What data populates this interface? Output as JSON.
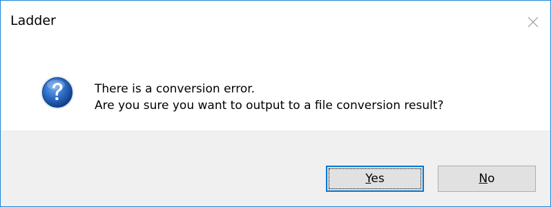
{
  "window": {
    "title": "Ladder"
  },
  "message": {
    "line1": "There is a conversion error.",
    "line2": "Are you sure you want to output to a file conversion result?"
  },
  "buttons": {
    "yes": {
      "mnemonic": "Y",
      "rest": "es"
    },
    "no": {
      "mnemonic": "N",
      "rest": "o"
    }
  },
  "icons": {
    "title_close": "close-icon",
    "message_icon": "question-icon"
  },
  "colors": {
    "window_border": "#1883d7",
    "footer_bg": "#f0f0f0",
    "button_bg": "#e1e1e1",
    "focus_border": "#0078d7",
    "icon_blue": "#1c5fb8"
  }
}
